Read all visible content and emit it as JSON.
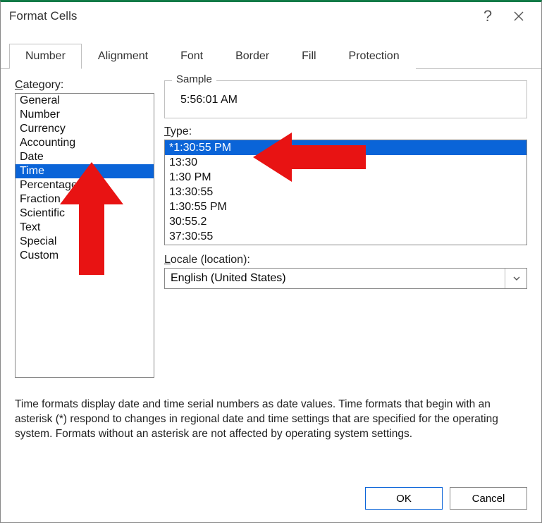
{
  "title": "Format Cells",
  "tabs": [
    "Number",
    "Alignment",
    "Font",
    "Border",
    "Fill",
    "Protection"
  ],
  "activeTab": 0,
  "categoryLabel": "Category:",
  "categories": [
    "General",
    "Number",
    "Currency",
    "Accounting",
    "Date",
    "Time",
    "Percentage",
    "Fraction",
    "Scientific",
    "Text",
    "Special",
    "Custom"
  ],
  "selectedCategory": 5,
  "sample": {
    "legend": "Sample",
    "value": "5:56:01 AM"
  },
  "typeLabel": "Type:",
  "types": [
    "*1:30:55 PM",
    "13:30",
    "1:30 PM",
    "13:30:55",
    "1:30:55 PM",
    "30:55.2",
    "37:30:55"
  ],
  "selectedType": 0,
  "localeLabel": "Locale (location):",
  "localeValue": "English (United States)",
  "description": "Time formats display date and time serial numbers as date values.  Time formats that begin with an asterisk (*) respond to changes in regional date and time settings that are specified for the operating system. Formats without an asterisk are not affected by operating system settings.",
  "buttons": {
    "ok": "OK",
    "cancel": "Cancel"
  }
}
